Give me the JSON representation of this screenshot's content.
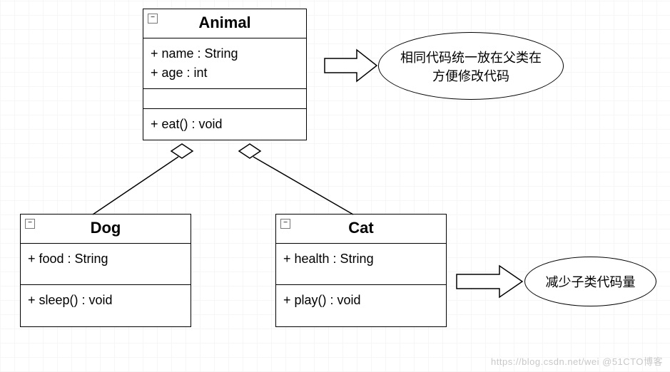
{
  "chart_data": {
    "type": "uml_class_diagram",
    "classes": [
      {
        "name": "Animal",
        "attributes": [
          {
            "visibility": "+",
            "name": "name",
            "type": "String"
          },
          {
            "visibility": "+",
            "name": "age",
            "type": "int"
          }
        ],
        "methods": [
          {
            "visibility": "+",
            "name": "eat()",
            "returns": "void"
          }
        ]
      },
      {
        "name": "Dog",
        "attributes": [
          {
            "visibility": "+",
            "name": "food",
            "type": "String"
          }
        ],
        "methods": [
          {
            "visibility": "+",
            "name": "sleep()",
            "returns": "void"
          }
        ]
      },
      {
        "name": "Cat",
        "attributes": [
          {
            "visibility": "+",
            "name": "health",
            "type": "String"
          }
        ],
        "methods": [
          {
            "visibility": "+",
            "name": "play()",
            "returns": "void"
          }
        ]
      }
    ],
    "relationships": [
      {
        "from": "Dog",
        "to": "Animal",
        "type": "aggregation"
      },
      {
        "from": "Cat",
        "to": "Animal",
        "type": "aggregation"
      }
    ],
    "annotations": [
      {
        "target": "Animal",
        "text_lines": [
          "相同代码统一放在父类在",
          "方便修改代码"
        ]
      },
      {
        "target": "Cat",
        "text_lines": [
          "减少子类代码量"
        ]
      }
    ]
  },
  "animal": {
    "title": "Animal",
    "attr1": "+ name : String",
    "attr2": "+ age : int",
    "method1": "+ eat() : void"
  },
  "dog": {
    "title": "Dog",
    "attr1": "+ food : String",
    "method1": "+ sleep() : void"
  },
  "cat": {
    "title": "Cat",
    "attr1": "+ health : String",
    "method1": "+ play() : void"
  },
  "note1_line1": "相同代码统一放在父类在",
  "note1_line2": "方便修改代码",
  "note2": "减少子类代码量",
  "collapse_glyph": "−",
  "watermark": "https://blog.csdn.net/wei @51CTO博客"
}
